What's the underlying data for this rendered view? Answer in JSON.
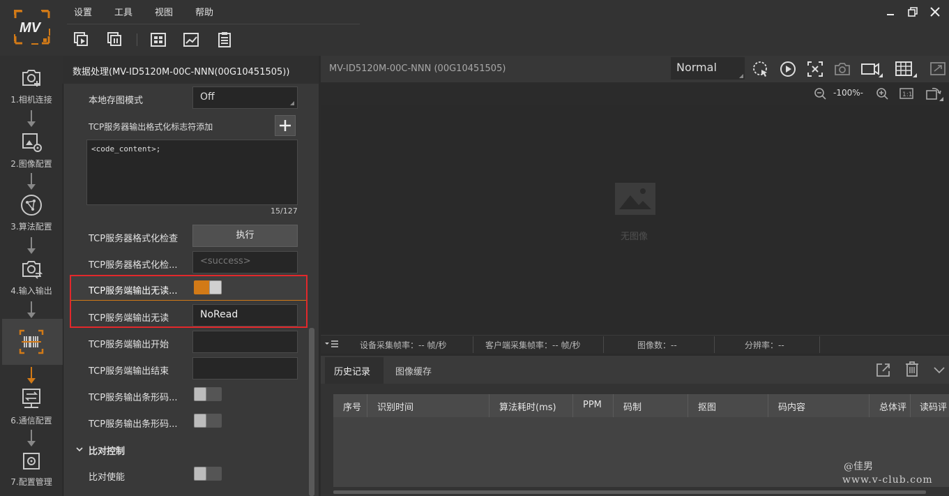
{
  "menu": {
    "items": [
      "设置",
      "工具",
      "视图",
      "帮助"
    ]
  },
  "toolbar": {
    "icons": [
      "start-capture-icon",
      "stop-capture-icon",
      "layout-icon",
      "chart-icon",
      "clipboard-icon"
    ]
  },
  "nav": {
    "items": [
      {
        "label": "1.相机连接",
        "icon": "camera-link-icon"
      },
      {
        "label": "2.图像配置",
        "icon": "image-settings-icon"
      },
      {
        "label": "3.算法配置",
        "icon": "algorithm-icon"
      },
      {
        "label": "4.输入输出",
        "icon": "io-icon"
      },
      {
        "label": "",
        "icon": "barcode-scan-icon"
      },
      {
        "label": "6.通信配置",
        "icon": "communication-icon"
      },
      {
        "label": "7.配置管理",
        "icon": "config-management-icon"
      }
    ]
  },
  "panel": {
    "title": "数据处理(MV-ID5120M-00C-NNN(00G10451505))",
    "local_save_label": "本地存图模式",
    "local_save_value": "Off",
    "format_add_label": "TCP服务器输出格式化标志符添加",
    "format_text": "<code_content>;",
    "format_counter": "15/127",
    "format_check_label": "TCP服务器格式化检查",
    "format_check_button": "执行",
    "format_check_result_label": "TCP服务器格式化检...",
    "format_check_result_placeholder": "<success>",
    "noread_enable_label": "TCP服务端输出无读...",
    "noread_enable": true,
    "noread_label": "TCP服务端输出无读",
    "noread_value": "NoRead",
    "start_label": "TCP服务端输出开始",
    "start_value": "",
    "end_label": "TCP服务端输出结束",
    "end_value": "",
    "barcode_out1_label": "TCP服务输出条形码...",
    "barcode_out2_label": "TCP服务输出条形码...",
    "compare_section": "比对控制",
    "compare_enable_label": "比对使能"
  },
  "viewer": {
    "title": "MV-ID5120M-00C-NNN (00G10451505)",
    "mode": "Normal",
    "zoom": "-100%-",
    "no_image": "无图像"
  },
  "stats": {
    "device_fps": "设备采集帧率：-- 帧/秒",
    "client_fps": "客户端采集帧率：-- 帧/秒",
    "image_count": "图像数：--",
    "resolution": "分辨率：--"
  },
  "history": {
    "tabs": [
      "历史记录",
      "图像缓存"
    ],
    "columns": [
      "序号",
      "识别时间",
      "算法耗时(ms)",
      "PPM",
      "码制",
      "抠图",
      "码内容",
      "总体评",
      "读码评"
    ]
  },
  "watermark": {
    "line1": "@佳男",
    "line2": "www.v-club.com"
  },
  "colors": {
    "accent": "#d27a17",
    "highlight_box": "#e2282b"
  }
}
